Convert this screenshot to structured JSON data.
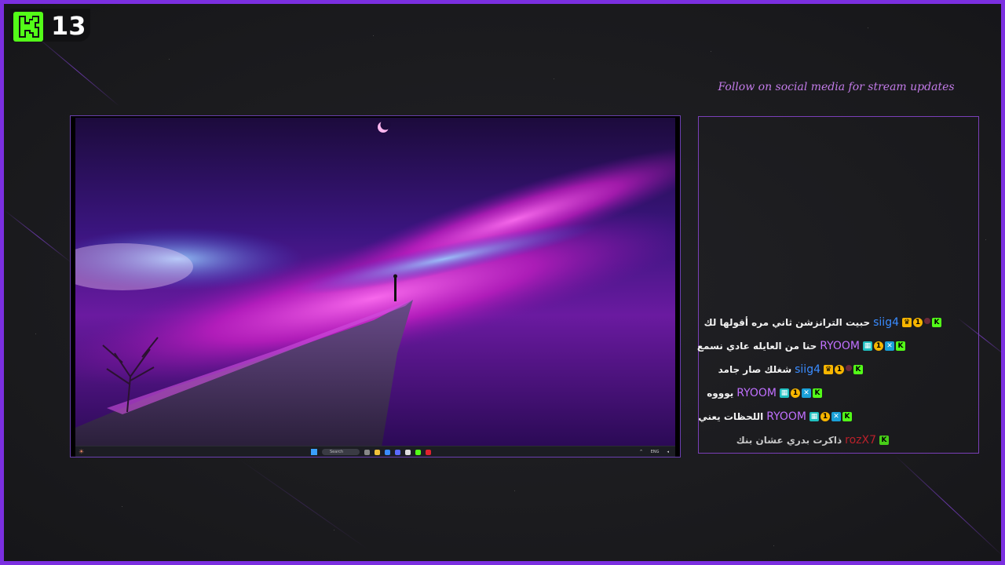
{
  "overlay": {
    "viewer_count": "13",
    "logo_icon": "kick-logo-icon",
    "accent_color": "#7b2fe0",
    "kick_green": "#53fc18",
    "follow_text": "Follow on social media for stream updates"
  },
  "screen": {
    "taskbar": {
      "search_label": "Search",
      "lang": "ENG"
    }
  },
  "chat": {
    "messages": [
      {
        "user": "siig4",
        "user_color": "#3a8cff",
        "text": "حبيت الترانزشن ثاني مره أقولها لك"
      },
      {
        "user": "RYOOM",
        "user_color": "#c070ff",
        "text": "حنا من العايله عادي نسمع"
      },
      {
        "user": "siig4",
        "user_color": "#3a8cff",
        "text": "شغلك صار جامد"
      },
      {
        "user": "RYOOM",
        "user_color": "#c070ff",
        "text": "يوووه"
      },
      {
        "user": "RYOOM",
        "user_color": "#c070ff",
        "text": "اللحظات يعني"
      },
      {
        "user": "rozX7",
        "user_color": "#e0222e",
        "text": "ذاكرت بدري عشان بنك"
      }
    ]
  }
}
